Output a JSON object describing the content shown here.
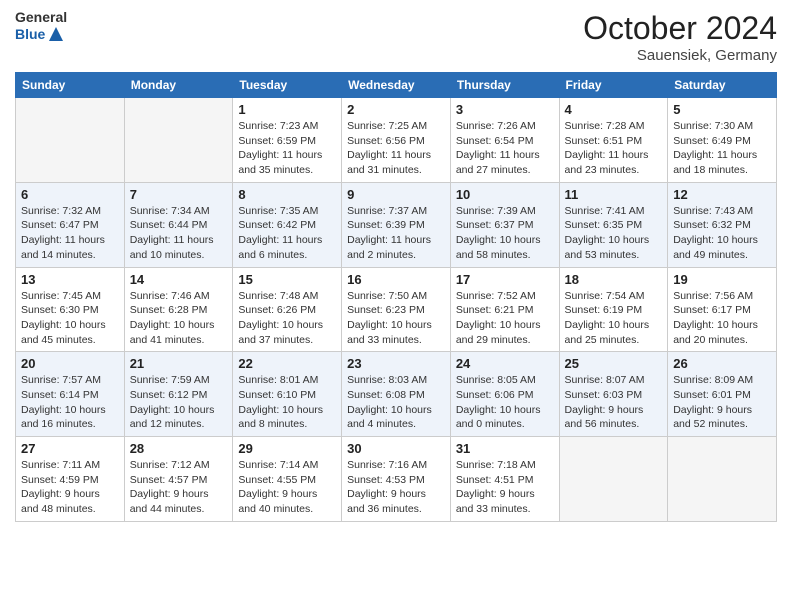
{
  "header": {
    "logo_general": "General",
    "logo_blue": "Blue",
    "month": "October 2024",
    "location": "Sauensiek, Germany"
  },
  "weekdays": [
    "Sunday",
    "Monday",
    "Tuesday",
    "Wednesday",
    "Thursday",
    "Friday",
    "Saturday"
  ],
  "weeks": [
    [
      {
        "day": null,
        "sunrise": null,
        "sunset": null,
        "daylight": null
      },
      {
        "day": null,
        "sunrise": null,
        "sunset": null,
        "daylight": null
      },
      {
        "day": "1",
        "sunrise": "Sunrise: 7:23 AM",
        "sunset": "Sunset: 6:59 PM",
        "daylight": "Daylight: 11 hours and 35 minutes."
      },
      {
        "day": "2",
        "sunrise": "Sunrise: 7:25 AM",
        "sunset": "Sunset: 6:56 PM",
        "daylight": "Daylight: 11 hours and 31 minutes."
      },
      {
        "day": "3",
        "sunrise": "Sunrise: 7:26 AM",
        "sunset": "Sunset: 6:54 PM",
        "daylight": "Daylight: 11 hours and 27 minutes."
      },
      {
        "day": "4",
        "sunrise": "Sunrise: 7:28 AM",
        "sunset": "Sunset: 6:51 PM",
        "daylight": "Daylight: 11 hours and 23 minutes."
      },
      {
        "day": "5",
        "sunrise": "Sunrise: 7:30 AM",
        "sunset": "Sunset: 6:49 PM",
        "daylight": "Daylight: 11 hours and 18 minutes."
      }
    ],
    [
      {
        "day": "6",
        "sunrise": "Sunrise: 7:32 AM",
        "sunset": "Sunset: 6:47 PM",
        "daylight": "Daylight: 11 hours and 14 minutes."
      },
      {
        "day": "7",
        "sunrise": "Sunrise: 7:34 AM",
        "sunset": "Sunset: 6:44 PM",
        "daylight": "Daylight: 11 hours and 10 minutes."
      },
      {
        "day": "8",
        "sunrise": "Sunrise: 7:35 AM",
        "sunset": "Sunset: 6:42 PM",
        "daylight": "Daylight: 11 hours and 6 minutes."
      },
      {
        "day": "9",
        "sunrise": "Sunrise: 7:37 AM",
        "sunset": "Sunset: 6:39 PM",
        "daylight": "Daylight: 11 hours and 2 minutes."
      },
      {
        "day": "10",
        "sunrise": "Sunrise: 7:39 AM",
        "sunset": "Sunset: 6:37 PM",
        "daylight": "Daylight: 10 hours and 58 minutes."
      },
      {
        "day": "11",
        "sunrise": "Sunrise: 7:41 AM",
        "sunset": "Sunset: 6:35 PM",
        "daylight": "Daylight: 10 hours and 53 minutes."
      },
      {
        "day": "12",
        "sunrise": "Sunrise: 7:43 AM",
        "sunset": "Sunset: 6:32 PM",
        "daylight": "Daylight: 10 hours and 49 minutes."
      }
    ],
    [
      {
        "day": "13",
        "sunrise": "Sunrise: 7:45 AM",
        "sunset": "Sunset: 6:30 PM",
        "daylight": "Daylight: 10 hours and 45 minutes."
      },
      {
        "day": "14",
        "sunrise": "Sunrise: 7:46 AM",
        "sunset": "Sunset: 6:28 PM",
        "daylight": "Daylight: 10 hours and 41 minutes."
      },
      {
        "day": "15",
        "sunrise": "Sunrise: 7:48 AM",
        "sunset": "Sunset: 6:26 PM",
        "daylight": "Daylight: 10 hours and 37 minutes."
      },
      {
        "day": "16",
        "sunrise": "Sunrise: 7:50 AM",
        "sunset": "Sunset: 6:23 PM",
        "daylight": "Daylight: 10 hours and 33 minutes."
      },
      {
        "day": "17",
        "sunrise": "Sunrise: 7:52 AM",
        "sunset": "Sunset: 6:21 PM",
        "daylight": "Daylight: 10 hours and 29 minutes."
      },
      {
        "day": "18",
        "sunrise": "Sunrise: 7:54 AM",
        "sunset": "Sunset: 6:19 PM",
        "daylight": "Daylight: 10 hours and 25 minutes."
      },
      {
        "day": "19",
        "sunrise": "Sunrise: 7:56 AM",
        "sunset": "Sunset: 6:17 PM",
        "daylight": "Daylight: 10 hours and 20 minutes."
      }
    ],
    [
      {
        "day": "20",
        "sunrise": "Sunrise: 7:57 AM",
        "sunset": "Sunset: 6:14 PM",
        "daylight": "Daylight: 10 hours and 16 minutes."
      },
      {
        "day": "21",
        "sunrise": "Sunrise: 7:59 AM",
        "sunset": "Sunset: 6:12 PM",
        "daylight": "Daylight: 10 hours and 12 minutes."
      },
      {
        "day": "22",
        "sunrise": "Sunrise: 8:01 AM",
        "sunset": "Sunset: 6:10 PM",
        "daylight": "Daylight: 10 hours and 8 minutes."
      },
      {
        "day": "23",
        "sunrise": "Sunrise: 8:03 AM",
        "sunset": "Sunset: 6:08 PM",
        "daylight": "Daylight: 10 hours and 4 minutes."
      },
      {
        "day": "24",
        "sunrise": "Sunrise: 8:05 AM",
        "sunset": "Sunset: 6:06 PM",
        "daylight": "Daylight: 10 hours and 0 minutes."
      },
      {
        "day": "25",
        "sunrise": "Sunrise: 8:07 AM",
        "sunset": "Sunset: 6:03 PM",
        "daylight": "Daylight: 9 hours and 56 minutes."
      },
      {
        "day": "26",
        "sunrise": "Sunrise: 8:09 AM",
        "sunset": "Sunset: 6:01 PM",
        "daylight": "Daylight: 9 hours and 52 minutes."
      }
    ],
    [
      {
        "day": "27",
        "sunrise": "Sunrise: 7:11 AM",
        "sunset": "Sunset: 4:59 PM",
        "daylight": "Daylight: 9 hours and 48 minutes."
      },
      {
        "day": "28",
        "sunrise": "Sunrise: 7:12 AM",
        "sunset": "Sunset: 4:57 PM",
        "daylight": "Daylight: 9 hours and 44 minutes."
      },
      {
        "day": "29",
        "sunrise": "Sunrise: 7:14 AM",
        "sunset": "Sunset: 4:55 PM",
        "daylight": "Daylight: 9 hours and 40 minutes."
      },
      {
        "day": "30",
        "sunrise": "Sunrise: 7:16 AM",
        "sunset": "Sunset: 4:53 PM",
        "daylight": "Daylight: 9 hours and 36 minutes."
      },
      {
        "day": "31",
        "sunrise": "Sunrise: 7:18 AM",
        "sunset": "Sunset: 4:51 PM",
        "daylight": "Daylight: 9 hours and 33 minutes."
      },
      {
        "day": null,
        "sunrise": null,
        "sunset": null,
        "daylight": null
      },
      {
        "day": null,
        "sunrise": null,
        "sunset": null,
        "daylight": null
      }
    ]
  ]
}
